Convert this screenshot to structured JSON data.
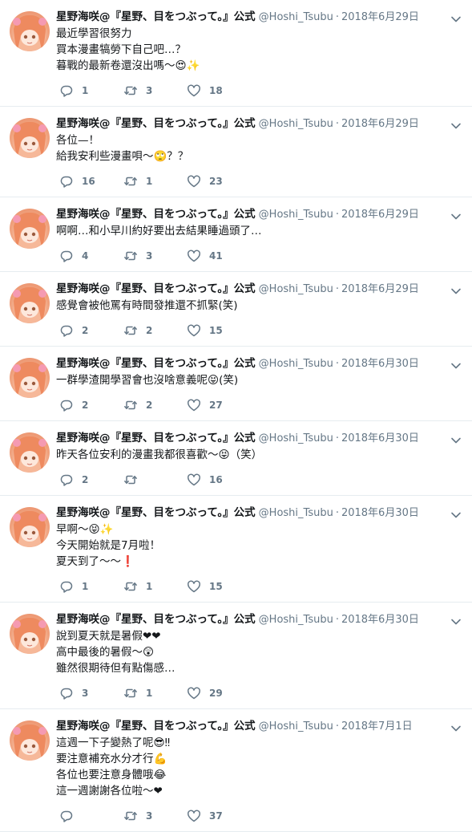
{
  "tweets": [
    {
      "name": "星野海咲@『星野、目をつぶって。』公式",
      "handle": "@Hoshi_Tsubu",
      "date": "2018年6月29日",
      "lines": [
        "最近學習很努力",
        "買本漫畫犒勞下自己吧…？",
        "暮戰的最新卷還沒出嗎〜😍✨"
      ],
      "replies": "1",
      "retweets": "3",
      "likes": "18"
    },
    {
      "name": "星野海咲@『星野、目をつぶって。』公式",
      "handle": "@Hoshi_Tsubu",
      "date": "2018年6月29日",
      "lines": [
        "各位—！",
        "給我安利些漫畫唄〜🙄？？"
      ],
      "replies": "16",
      "retweets": "1",
      "likes": "23"
    },
    {
      "name": "星野海咲@『星野、目をつぶって。』公式",
      "handle": "@Hoshi_Tsubu",
      "date": "2018年6月29日",
      "lines": [
        "啊啊…和小早川約好要出去結果睡過頭了…"
      ],
      "replies": "4",
      "retweets": "3",
      "likes": "41"
    },
    {
      "name": "星野海咲@『星野、目をつぶって。』公式",
      "handle": "@Hoshi_Tsubu",
      "date": "2018年6月29日",
      "lines": [
        "感覺會被他罵有時間發推還不抓緊(笑)"
      ],
      "replies": "2",
      "retweets": "2",
      "likes": "15"
    },
    {
      "name": "星野海咲@『星野、目をつぶって。』公式",
      "handle": "@Hoshi_Tsubu",
      "date": "2018年6月30日",
      "lines": [
        "一群學渣開學習會也沒啥意義呢😝(笑)"
      ],
      "replies": "2",
      "retweets": "2",
      "likes": "27"
    },
    {
      "name": "星野海咲@『星野、目をつぶって。』公式",
      "handle": "@Hoshi_Tsubu",
      "date": "2018年6月30日",
      "lines": [
        "昨天各位安利的漫畫我都很喜歡〜😝（笑）"
      ],
      "replies": "2",
      "retweets": "",
      "likes": "16"
    },
    {
      "name": "星野海咲@『星野、目をつぶって。』公式",
      "handle": "@Hoshi_Tsubu",
      "date": "2018年6月30日",
      "lines": [
        "早啊〜😝✨",
        "今天開始就是7月啦！",
        "夏天到了〜〜❗"
      ],
      "replies": "1",
      "retweets": "1",
      "likes": "15"
    },
    {
      "name": "星野海咲@『星野、目をつぶって。』公式",
      "handle": "@Hoshi_Tsubu",
      "date": "2018年6月30日",
      "lines": [
        "說到夏天就是暑假❤❤",
        "高中最後的暑假〜😲",
        "雖然很期待但有點傷感…"
      ],
      "replies": "3",
      "retweets": "1",
      "likes": "29"
    },
    {
      "name": "星野海咲@『星野、目をつぶって。』公式",
      "handle": "@Hoshi_Tsubu",
      "date": "2018年7月1日",
      "lines": [
        "這週一下子變熱了呢😎‼",
        "要注意補充水分才行💪",
        "各位也要注意身體哦😂",
        "這一週謝謝各位啦〜❤"
      ],
      "replies": "",
      "retweets": "3",
      "likes": "37"
    }
  ],
  "icons": {
    "reply": "reply-icon",
    "retweet": "retweet-icon",
    "like": "heart-icon",
    "caret": "chevron-down-icon",
    "avatar": "avatar"
  },
  "colors": {
    "muted": "#657786",
    "text": "#14171a",
    "divider": "#e6ecf0"
  }
}
